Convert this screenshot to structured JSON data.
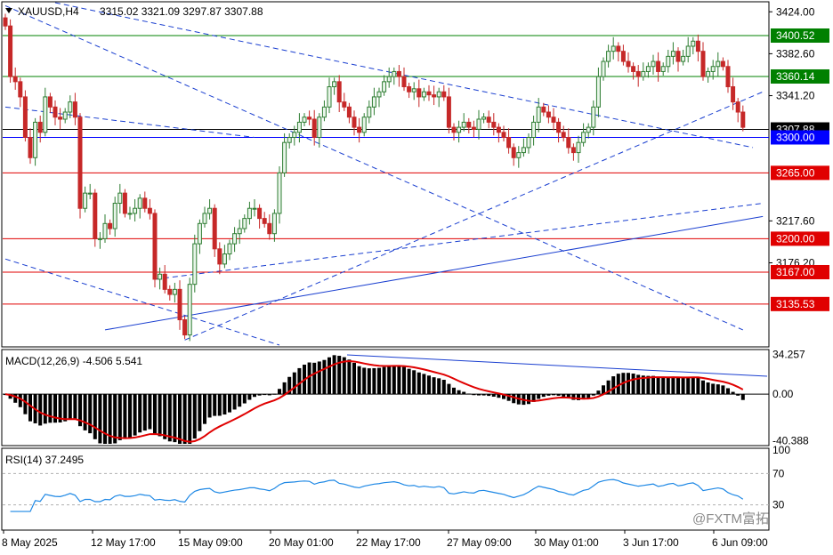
{
  "header": {
    "symbol_tf": "XAUUSD,H4",
    "ohlc": "3315.02 3321.09 3297.87 3307.88"
  },
  "macd": {
    "label": "MACD(12,26,9) -4.506 5.541"
  },
  "rsi": {
    "label": "RSI(14) 37.2495"
  },
  "watermark": "@FXTM富拓",
  "colors": {
    "bull": "#2e7d32",
    "bear": "#c62828",
    "signal": "#e00000",
    "rsi_line": "#1e88e5",
    "hline_red": "#e00000",
    "hline_green": "#008000",
    "hline_blue": "#0000ff"
  },
  "chart_data": [
    {
      "type": "candlestick",
      "title": "XAUUSD,H4",
      "ylim": [
        3095,
        3433
      ],
      "y_ticks": [
        3424.0,
        3382.6,
        3341.2,
        3217.6,
        3176.2
      ],
      "x_tick_labels": [
        "8 May 2025",
        "12 May 17:00",
        "15 May 09:00",
        "20 May 01:00",
        "22 May 17:00",
        "27 May 09:00",
        "30 May 01:00",
        "3 Jun 17:00",
        "6 Jun 09:00"
      ],
      "price_levels": [
        {
          "value": 3400.52,
          "label": "3400.52",
          "color": "green"
        },
        {
          "value": 3360.14,
          "label": "3360.14",
          "color": "green"
        },
        {
          "value": 3307.88,
          "label": "3307.88",
          "color": "black"
        },
        {
          "value": 3300.0,
          "label": "3300.00",
          "color": "blue"
        },
        {
          "value": 3265.0,
          "label": "3265.00",
          "color": "red"
        },
        {
          "value": 3200.0,
          "label": "3200.00",
          "color": "red"
        },
        {
          "value": 3167.0,
          "label": "3167.00",
          "color": "red"
        },
        {
          "value": 3135.53,
          "label": "3135.53",
          "color": "red"
        }
      ],
      "closes": [
        3410,
        3360,
        3355,
        3340,
        3300,
        3280,
        3315,
        3305,
        3340,
        3330,
        3320,
        3318,
        3325,
        3335,
        3320,
        3230,
        3245,
        3245,
        3200,
        3200,
        3215,
        3210,
        3235,
        3245,
        3225,
        3225,
        3230,
        3240,
        3230,
        3225,
        3160,
        3165,
        3150,
        3145,
        3150,
        3120,
        3105,
        3155,
        3195,
        3215,
        3225,
        3230,
        3190,
        3175,
        3185,
        3195,
        3205,
        3210,
        3220,
        3230,
        3230,
        3220,
        3215,
        3205,
        3225,
        3265,
        3295,
        3300,
        3305,
        3315,
        3320,
        3318,
        3300,
        3320,
        3330,
        3350,
        3355,
        3335,
        3330,
        3320,
        3310,
        3305,
        3320,
        3330,
        3340,
        3345,
        3355,
        3360,
        3365,
        3360,
        3350,
        3345,
        3348,
        3340,
        3345,
        3342,
        3340,
        3345,
        3340,
        3310,
        3305,
        3310,
        3315,
        3310,
        3308,
        3318,
        3320,
        3315,
        3310,
        3305,
        3300,
        3290,
        3280,
        3285,
        3290,
        3300,
        3315,
        3330,
        3325,
        3320,
        3315,
        3305,
        3300,
        3290,
        3285,
        3295,
        3305,
        3310,
        3330,
        3360,
        3375,
        3385,
        3390,
        3385,
        3375,
        3370,
        3365,
        3360,
        3365,
        3370,
        3375,
        3365,
        3370,
        3380,
        3385,
        3375,
        3380,
        3390,
        3395,
        3385,
        3360,
        3365,
        3370,
        3375,
        3370,
        3350,
        3335,
        3325,
        3310
      ],
      "macd": {
        "value": -4.506,
        "signal": 5.541,
        "ylim": [
          -43,
          37
        ],
        "y_ticks": [
          34.257,
          0.0,
          -40.388
        ]
      },
      "rsi": {
        "value": 37.2495,
        "ylim": [
          0,
          100
        ],
        "levels": [
          70,
          30
        ],
        "y_ticks": [
          100,
          70,
          30
        ]
      }
    }
  ]
}
